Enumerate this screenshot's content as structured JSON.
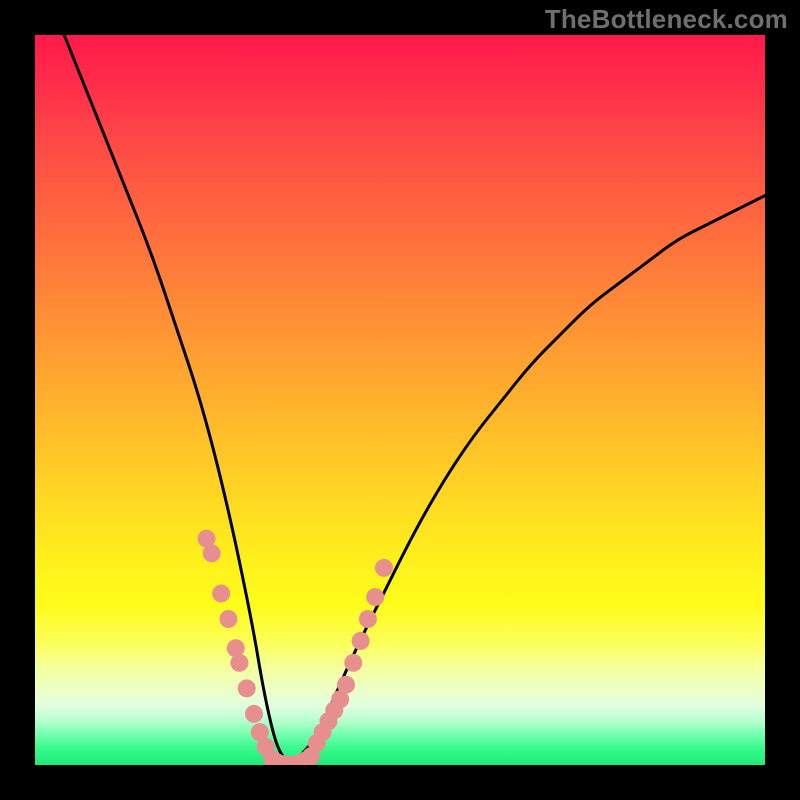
{
  "watermark": "TheBottleneck.com",
  "colors": {
    "background": "#000000",
    "curve": "#000000",
    "dot": "#e78f8f",
    "gradient_top": "#ff1a4a",
    "gradient_mid": "#fff01c",
    "gradient_bottom": "#1fe97a"
  },
  "chart_data": {
    "type": "line",
    "title": "",
    "xlabel": "",
    "ylabel": "",
    "xlim": [
      0,
      100
    ],
    "ylim": [
      0,
      100
    ],
    "series": [
      {
        "name": "curve",
        "x": [
          4,
          8,
          12,
          16,
          20,
          22,
          24,
          26,
          28,
          30,
          31,
          32,
          33,
          34,
          35,
          36,
          38,
          40,
          44,
          48,
          52,
          56,
          60,
          64,
          68,
          72,
          76,
          80,
          84,
          88,
          92,
          96,
          100
        ],
        "values": [
          100,
          90,
          80,
          70,
          58,
          52,
          45,
          37,
          28,
          18,
          12,
          7,
          3,
          1,
          0,
          1,
          3,
          7,
          16,
          24,
          32,
          39,
          45,
          50,
          55,
          59,
          63,
          66,
          69,
          72,
          74,
          76,
          78
        ]
      },
      {
        "name": "clustered-dots-left",
        "x": [
          23.5,
          24.2,
          25.5,
          26.5,
          27.5,
          28.0,
          29.0,
          30.0,
          30.8,
          31.6
        ],
        "values": [
          31.0,
          29.0,
          23.5,
          20.0,
          16.0,
          14.0,
          10.5,
          7.0,
          4.5,
          2.5
        ]
      },
      {
        "name": "clustered-dots-bottom",
        "x": [
          32.5,
          33.3,
          34.2,
          35.0,
          36.0,
          37.0,
          37.8
        ],
        "values": [
          0.8,
          0.3,
          0.1,
          0.0,
          0.2,
          0.6,
          1.2
        ]
      },
      {
        "name": "clustered-dots-right",
        "x": [
          38.6,
          39.4,
          40.2,
          41.0,
          41.8,
          42.6,
          43.6,
          44.6,
          45.6,
          46.6,
          47.8
        ],
        "values": [
          3.0,
          4.5,
          6.0,
          7.5,
          9.0,
          11.0,
          14.0,
          17.0,
          20.0,
          23.0,
          27.0
        ]
      }
    ]
  }
}
